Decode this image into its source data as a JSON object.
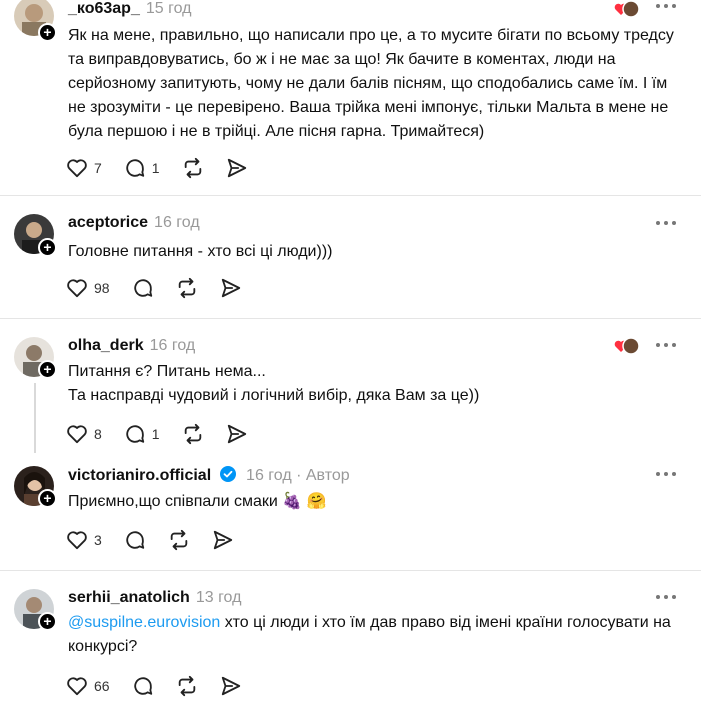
{
  "comments": [
    {
      "username": "_ко63ар_",
      "time": "15 год",
      "text": "Як на мене, правильно, що написали про це, а то мусите бігати по всьому тредсу та виправдовуватись, бо ж і не має за що! Як бачите в коментах, люди на серйозному запитують, чому не дали балів пісням, що сподобались саме їм. І їм не зрозуміти - це перевірено. Ваша трійка мені імпонує, тільки Мальта в мене не була першою і не в трійці. Але пісня гарна. Тримайтеся)",
      "likes": "7",
      "replies": "1"
    },
    {
      "username": "aceptorice",
      "time": "16 год",
      "text": "Головне питання - хто всі ці люди)))",
      "likes": "98",
      "replies": ""
    },
    {
      "username": "olha_derk",
      "time": "16 год",
      "text": "Питання є? Питань нема...",
      "text2": "Та насправді чудовий і логічний вибір, дяка Вам за це))",
      "likes": "8",
      "replies": "1"
    },
    {
      "username": "victorianiro.official",
      "time": "16 год",
      "author_label": "· Автор",
      "text": "Приємно,що співпали смаки",
      "emojis": "🍇 🤗",
      "likes": "3",
      "replies": ""
    },
    {
      "username": "serhii_anatolich",
      "time": "13 год",
      "mention": "@suspilne.eurovision",
      "text": " хто ці люди і хто їм дав право від імені країни голосувати на конкурсі?",
      "likes": "66",
      "replies": ""
    }
  ],
  "colors": {
    "text": "#101010",
    "muted": "#999999",
    "link": "#1d9bf0",
    "verified": "#0095f6",
    "heart": "#ff3040",
    "divider": "#e5e5e5"
  },
  "icons": [
    "heart-icon",
    "comment-icon",
    "repost-icon",
    "share-icon",
    "more-icon",
    "plus-icon",
    "verified-icon"
  ]
}
